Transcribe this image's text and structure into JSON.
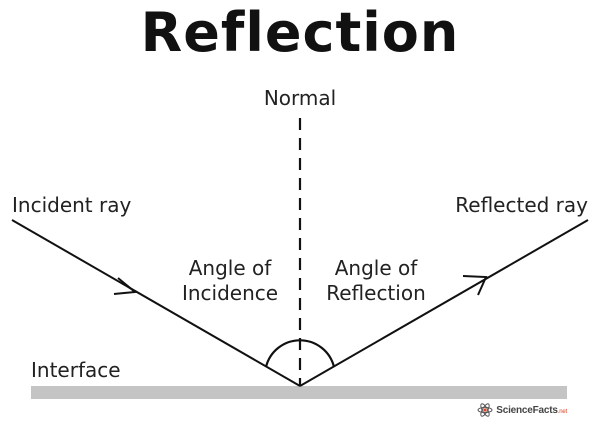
{
  "title": "Reflection",
  "labels": {
    "normal": "Normal",
    "incident_ray": "Incident ray",
    "reflected_ray": "Reflected ray",
    "interface": "Interface",
    "angle_of_incidence": [
      "Angle of",
      "Incidence"
    ],
    "angle_of_reflection": [
      "Angle of",
      "Reflection"
    ]
  },
  "logo": {
    "name": "ScienceFacts",
    "suffix": ".net"
  },
  "colors": {
    "ink": "#111111",
    "interface_surface": "#c4c4c4",
    "logo_accent": "#e0452a"
  },
  "icons": {
    "logo_mark": "atom-icon"
  }
}
